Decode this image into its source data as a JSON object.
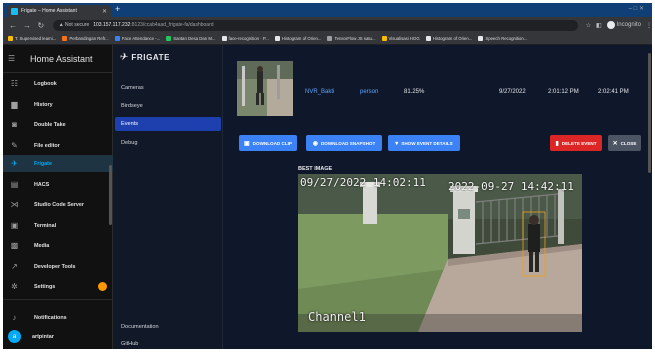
{
  "browser": {
    "tab_title": "Frigate – Home Assistant",
    "new_tab": "+",
    "window_controls": "– □ ✕",
    "url_warning": "▲ Not secure",
    "url_host": "103.157.117.232",
    "url_path": ":8123/ccab4aad_frigate-fa/dashboard",
    "incognito_label": "Incognito",
    "bookmarks": [
      {
        "label": "T. Supervised learni...",
        "color": "#fbbc04"
      },
      {
        "label": "Perbandingan Refr...",
        "color": "#f97316"
      },
      {
        "label": "Face Attendance -...",
        "color": "#3b82f6"
      },
      {
        "label": "Santan Desa Dan M...",
        "color": "#22c55e"
      },
      {
        "label": "face-recognition · P...",
        "color": "#e5e7eb"
      },
      {
        "label": "Histogram of Orien...",
        "color": "#e5e7eb"
      },
      {
        "label": "TensorFlow JS satu...",
        "color": "#9aa0a6"
      },
      {
        "label": "Visualisasi HOG",
        "color": "#fbbc04"
      },
      {
        "label": "Histogram of Orien...",
        "color": "#e5e7eb"
      },
      {
        "label": "Speech Recognition...",
        "color": "#e5e7eb"
      }
    ]
  },
  "ha": {
    "title": "Home Assistant",
    "items": [
      {
        "label": "Logbook",
        "icon": "logbook-icon"
      },
      {
        "label": "History",
        "icon": "history-icon"
      },
      {
        "label": "Double Take",
        "icon": "double-take-icon"
      },
      {
        "label": "File editor",
        "icon": "wrench-icon"
      },
      {
        "label": "Frigate",
        "icon": "frigate-icon"
      },
      {
        "label": "HACS",
        "icon": "hacs-icon"
      },
      {
        "label": "Studio Code Server",
        "icon": "vscode-icon"
      },
      {
        "label": "Terminal",
        "icon": "terminal-icon"
      },
      {
        "label": "Media",
        "icon": "media-icon"
      },
      {
        "label": "Developer Tools",
        "icon": "hammer-icon"
      },
      {
        "label": "Settings",
        "icon": "gear-icon"
      }
    ],
    "notifications": "Notifications",
    "user": "artpintar",
    "avatar_letter": "a"
  },
  "frigate": {
    "brand": "FRIGATE",
    "nav": [
      "Cameras",
      "Birdseye",
      "Events",
      "Debug"
    ],
    "footer": [
      "Documentation",
      "GitHub"
    ]
  },
  "event": {
    "camera": "NVR_Bakti",
    "label": "person",
    "score": "81.25%",
    "date": "9/27/2022",
    "start": "2:01:12 PM",
    "end": "2:02:41 PM"
  },
  "actions": {
    "download_clip": "DOWNLOAD CLIP",
    "download_snapshot": "DOWNLOAD SNAPSHOT",
    "show_details": "SHOW EVENT DETAILS",
    "delete": "DELETE EVENT",
    "close": "CLOSE"
  },
  "best_image": {
    "heading": "BEST IMAGE",
    "overlay_left": "09/27/2022 14:02:11",
    "overlay_right": "2022-09-27 14:42:11",
    "channel": "Channel1"
  }
}
